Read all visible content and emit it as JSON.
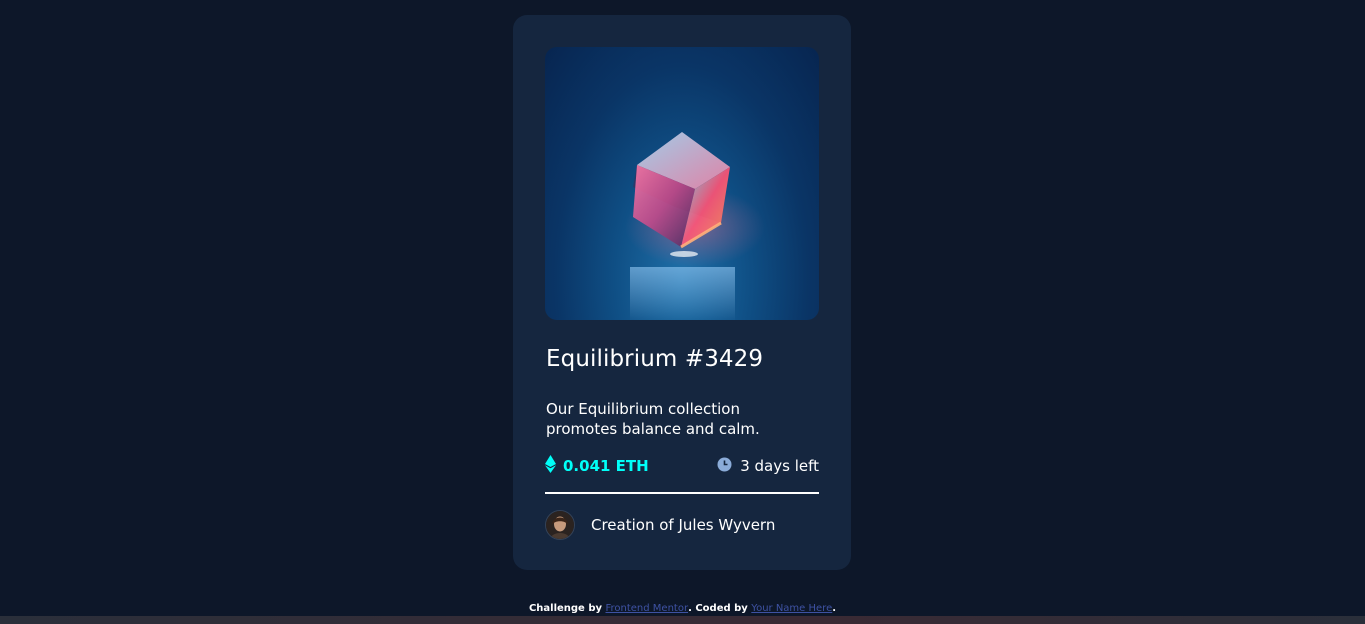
{
  "card": {
    "title": "Equilibrium #3429",
    "description": "Our Equilibrium collection promotes balance and calm.",
    "price": "0.041 ETH",
    "time_left": "3 days left",
    "creator_prefix": "Creation of ",
    "creator_name": "Jules Wyvern",
    "image_icon": "crystal-cube-image",
    "price_icon": "ethereum-icon",
    "time_icon": "clock-icon",
    "colors": {
      "page_bg": "#0d1729",
      "card_bg": "#15263f",
      "accent": "#00fff8",
      "muted": "#8bacd9"
    }
  },
  "footer": {
    "challenge_by": "Challenge by",
    "frontend_mentor": "Frontend Mentor",
    "coded_by": ". Coded by",
    "your_name": "Your Name Here",
    "end": "."
  }
}
